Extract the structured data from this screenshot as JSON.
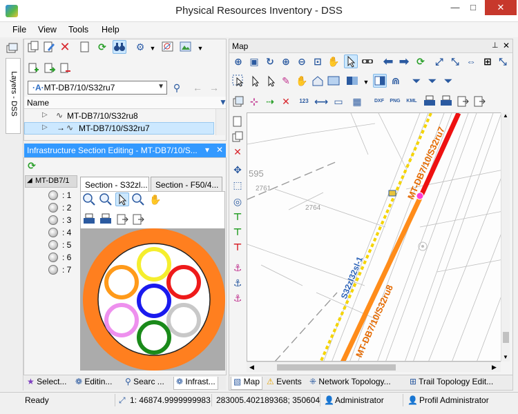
{
  "window": {
    "title": "Physical Resources Inventory - DSS",
    "min_glyph": "—",
    "max_glyph": "□",
    "close_glyph": "✕"
  },
  "menu": {
    "items": [
      "File",
      "View",
      "Tools",
      "Help"
    ]
  },
  "side_tab": {
    "label": "Layers - DSS"
  },
  "section_selector": {
    "value": "MT-DB7/10/S32ru7",
    "header": "Name",
    "rows": [
      {
        "label": "MT-DB7/10/S32ru8",
        "selected": false
      },
      {
        "label": "MT-DB7/10/S32ru7",
        "selected": true
      }
    ]
  },
  "infra_panel": {
    "title": "Infrastructure Section Editing - MT-DB7/10/S...",
    "tree_root": "MT-DB7/1",
    "fibers": [
      ": 1",
      ": 2",
      ": 3",
      ": 4",
      ": 5",
      ": 6",
      ": 7"
    ],
    "tabs": [
      "Section - S32zl...",
      "Section - F50/4..."
    ]
  },
  "left_bottom_tabs": [
    "Select...",
    "Editin...",
    "Searc ...",
    "Infrast..."
  ],
  "map_panel": {
    "title": "Map",
    "labels": {
      "cable_red": "MT-DB7/10/S32ru7",
      "cable_orange": "MT-DB7/10/S32ru8",
      "cable_yellow": "S32zl32sl-1",
      "parcel_595": "595",
      "parcel_2761": "2761",
      "parcel_2764": "2764"
    },
    "toolbar_text": {
      "dxf": "DXF",
      "png": "PNG",
      "kml": "KML",
      "ruler": "123"
    },
    "bottom_tabs": [
      "Map",
      "Events",
      "Network Topology...",
      "Trail Topology Edit..."
    ]
  },
  "status": {
    "state": "Ready",
    "scale": "1: 46874.9999999983",
    "coords": "283005.402189368; 350604",
    "user": "Administrator",
    "profile": "Profil Administrator"
  },
  "colors": {
    "accent_blue": "#3399ff",
    "cable_red": "#ee1111",
    "cable_orange": "#ff8c1a",
    "cable_yellow": "#f5d400",
    "jacket": "#ff7f1f"
  }
}
